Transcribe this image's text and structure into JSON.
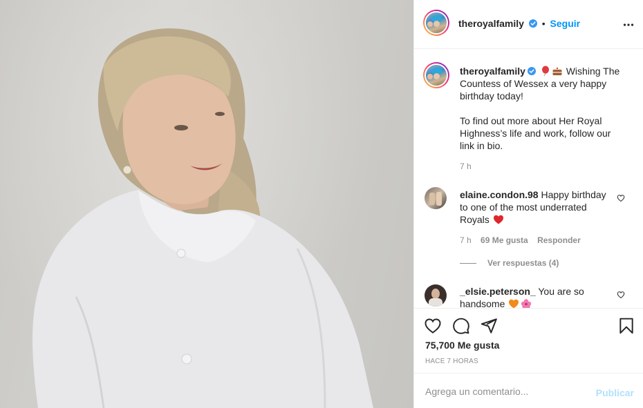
{
  "post": {
    "image_alt": "Portrait of the Countess of Wessex in a white coat against a grey wall"
  },
  "header": {
    "username": "theroyalfamily",
    "follow_label": "Seguir",
    "verified_icon": "verified-badge-icon",
    "more_icon": "more-options-icon"
  },
  "caption": {
    "username": "theroyalfamily",
    "emojis": [
      "balloon-emoji",
      "cake-emoji"
    ],
    "text_line1": "Wishing The Countess of Wessex a very happy birthday today!",
    "text_line2": "To find out more about Her Royal Highness’s life and work, follow our link in bio.",
    "time": "7 h"
  },
  "comments": [
    {
      "username": "elaine.condon.98",
      "text": "Happy birthday to one of the most underrated Royals",
      "emoji": "red-heart-emoji",
      "time": "7 h",
      "likes": "69 Me gusta",
      "reply_label": "Responder",
      "view_replies": "Ver respuestas (4)"
    },
    {
      "username": "_elsie.peterson_",
      "text": "You are so handsome",
      "emojis": [
        "orange-heart-emoji",
        "hibiscus-emoji"
      ]
    }
  ],
  "actions": {
    "like_icon": "heart-icon",
    "comment_icon": "comment-icon",
    "share_icon": "share-icon",
    "save_icon": "bookmark-icon",
    "likes_count": "75,700 Me gusta",
    "timestamp": "HACE 7 HORAS"
  },
  "add_comment": {
    "placeholder": "Agrega un comentario...",
    "publish_label": "Publicar"
  },
  "colors": {
    "link_blue": "#0095f6",
    "publish_disabled": "#b2dffc",
    "muted": "#8e8e8e",
    "text": "#262626",
    "heart_red": "#ed4956"
  }
}
